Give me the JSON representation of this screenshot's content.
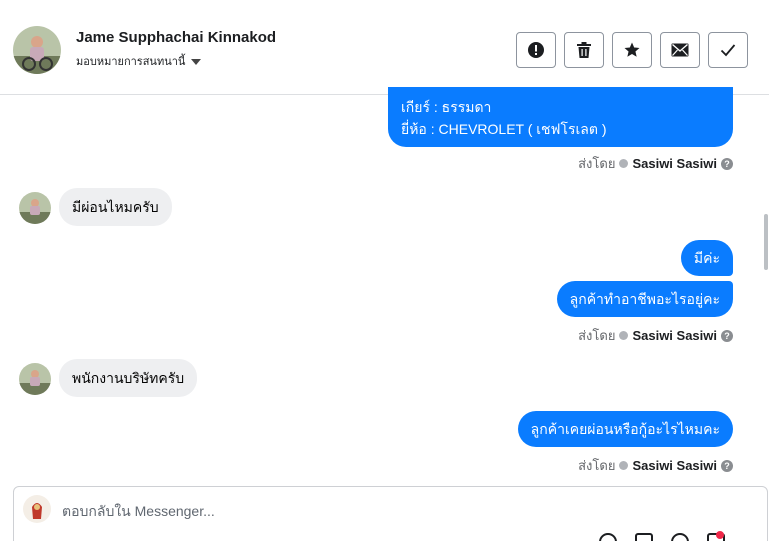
{
  "header": {
    "contact_name": "Jame Supphachai Kinnakod",
    "assign_label": "มอบหมายการสนทนานี้",
    "actions": [
      {
        "name": "report-icon"
      },
      {
        "name": "trash-icon"
      },
      {
        "name": "star-icon"
      },
      {
        "name": "envelope-icon"
      },
      {
        "name": "check-icon"
      }
    ]
  },
  "colors": {
    "outgoing_bubble": "#0a7cff",
    "incoming_bubble": "#eeeff1"
  },
  "messages": {
    "m1_line1": "เกียร์ : ธรรมดา",
    "m1_line2": "ยี่ห้อ : CHEVROLET ( เชฟโรเลต )",
    "m2": "มีผ่อนไหมครับ",
    "m3": "มีค่ะ",
    "m4": "ลูกค้าทำอาชีพอะไรอยู่คะ",
    "m5": "พนักงานบริษัทครับ",
    "m6": "ลูกค้าเคยผ่อนหรือกู้อะไรไหมคะ"
  },
  "sent_by": {
    "label": "ส่งโดย",
    "sender": "Sasiwi Sasiwi",
    "help": "?"
  },
  "composer": {
    "placeholder": "ตอบกลับใน Messenger..."
  }
}
